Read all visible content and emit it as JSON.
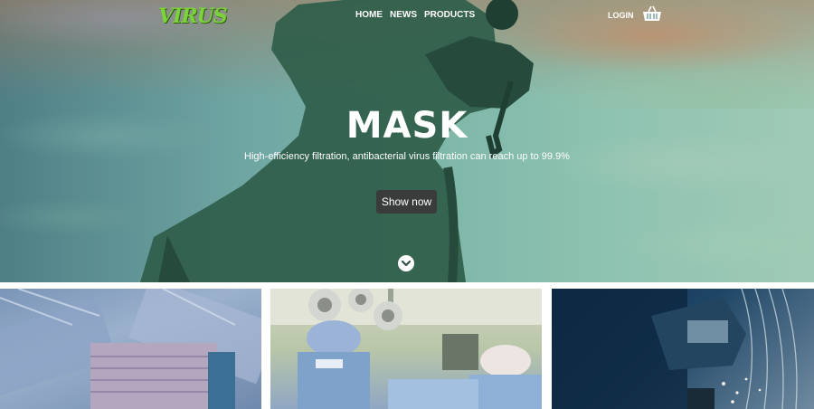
{
  "brand": {
    "logo_text": "VIRUS",
    "accent": "#7bd23a"
  },
  "nav": {
    "items": [
      {
        "label": "HOME"
      },
      {
        "label": "NEWS"
      },
      {
        "label": "PRODUCTS"
      }
    ],
    "login_label": "LOGIN",
    "cart_icon": "basket-icon"
  },
  "hero": {
    "title": "MASK",
    "subtitle": "High-efficiency filtration, antibacterial virus filtration can reach up to 99.9%",
    "button_label": "Show now",
    "scroll_icon": "chevron-down-circle-icon"
  },
  "tiles": [
    {
      "name": "surgical-masks-photo"
    },
    {
      "name": "operating-room-photo"
    },
    {
      "name": "welding-mask-photo"
    }
  ]
}
